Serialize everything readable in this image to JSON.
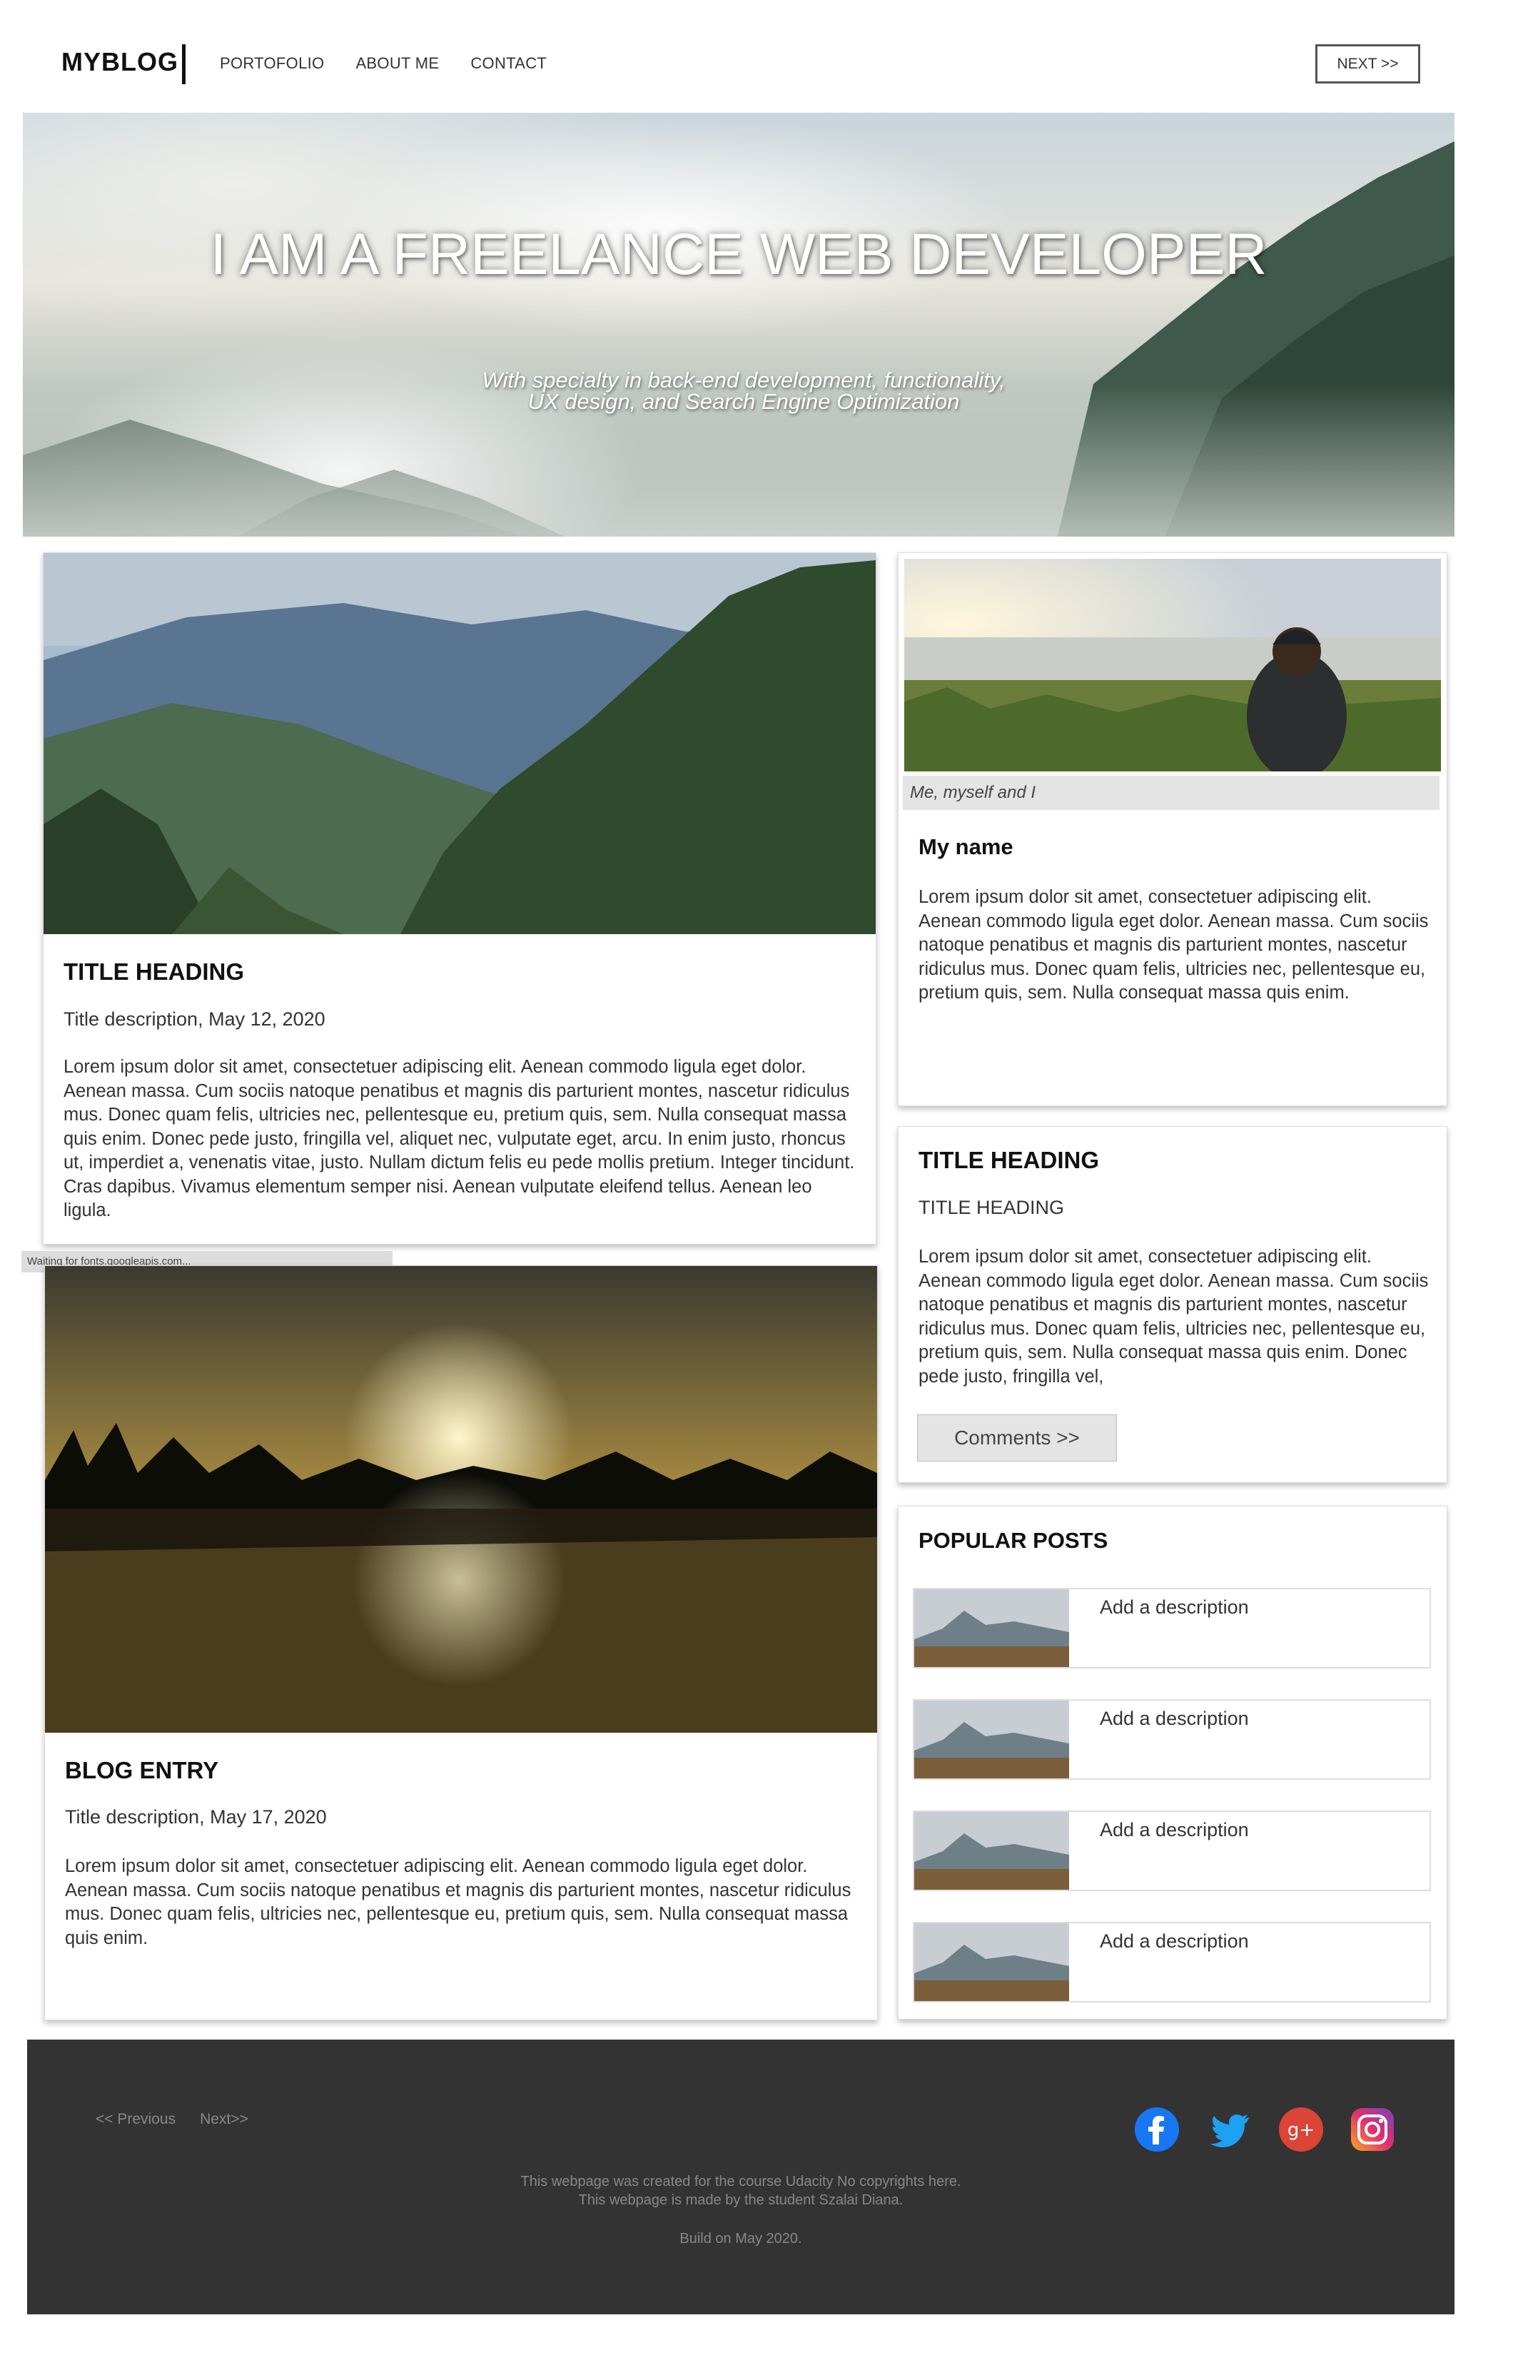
{
  "nav": {
    "brand": "MYBLOG",
    "links": [
      "PORTOFOLIO",
      "ABOUT ME",
      "CONTACT"
    ],
    "next_label": "NEXT >>"
  },
  "hero": {
    "title": "I AM A FREELANCE WEB DEVELOPER",
    "subtitle": "With specialty in back-end development, functionality, UX design, and Search Engine Optimization"
  },
  "posts": [
    {
      "title": "TITLE HEADING",
      "meta": "Title description, May 12, 2020",
      "body": "Lorem ipsum dolor sit amet, consectetuer adipiscing elit. Aenean commodo ligula eget dolor. Aenean massa. Cum sociis natoque penatibus et magnis dis parturient montes, nascetur ridiculus mus. Donec quam felis, ultricies nec, pellentesque eu, pretium quis, sem. Nulla consequat massa quis enim. Donec pede justo, fringilla vel, aliquet nec, vulputate eget, arcu. In enim justo, rhoncus ut, imperdiet a, venenatis vitae, justo. Nullam dictum felis eu pede mollis pretium. Integer tincidunt. Cras dapibus. Vivamus elementum semper nisi. Aenean vulputate eleifend tellus. Aenean leo ligula."
    },
    {
      "title": "BLOG ENTRY",
      "meta": "Title description, May 17, 2020",
      "body": "Lorem ipsum dolor sit amet, consectetuer adipiscing elit. Aenean commodo ligula eget dolor. Aenean massa. Cum sociis natoque penatibus et magnis dis parturient montes, nascetur ridiculus mus. Donec quam felis, ultricies nec, pellentesque eu, pretium quis, sem. Nulla consequat massa quis enim."
    }
  ],
  "status_bar": "Waiting for fonts.googleapis.com...",
  "about": {
    "caption": "Me, myself and I",
    "name": "My name",
    "body": "Lorem ipsum dolor sit amet, consectetuer adipiscing elit. Aenean commodo ligula eget dolor. Aenean massa. Cum sociis natoque penatibus et magnis dis parturient montes, nascetur ridiculus mus. Donec quam felis, ultricies nec, pellentesque eu, pretium quis, sem. Nulla consequat massa quis enim."
  },
  "side_post": {
    "title": "TITLE HEADING",
    "subtitle": "TITLE HEADING",
    "body": "Lorem ipsum dolor sit amet, consectetuer adipiscing elit. Aenean commodo ligula eget dolor. Aenean massa. Cum sociis natoque penatibus et magnis dis parturient montes, nascetur ridiculus mus. Donec quam felis, ultricies nec, pellentesque eu, pretium quis, sem. Nulla consequat massa quis enim. Donec pede justo, fringilla vel,",
    "button": "Comments >>"
  },
  "popular": {
    "title": "POPULAR POSTS",
    "items": [
      "Add a description",
      "Add a description",
      "Add a description",
      "Add a description"
    ]
  },
  "footer": {
    "prev": "<< Previous",
    "next": "Next>>",
    "line1": "This webpage was created for the course Udacity No copyrights here.",
    "line2": "This webpage is made by the student Szalai Diana.",
    "line3": "Build on May 2020.",
    "social": [
      "facebook-icon",
      "twitter-icon",
      "google-plus-icon",
      "instagram-icon"
    ],
    "colors": {
      "facebook": "#1877f2",
      "twitter": "#1da1f2",
      "google": "#db4437",
      "instagram": "#c13584"
    }
  }
}
